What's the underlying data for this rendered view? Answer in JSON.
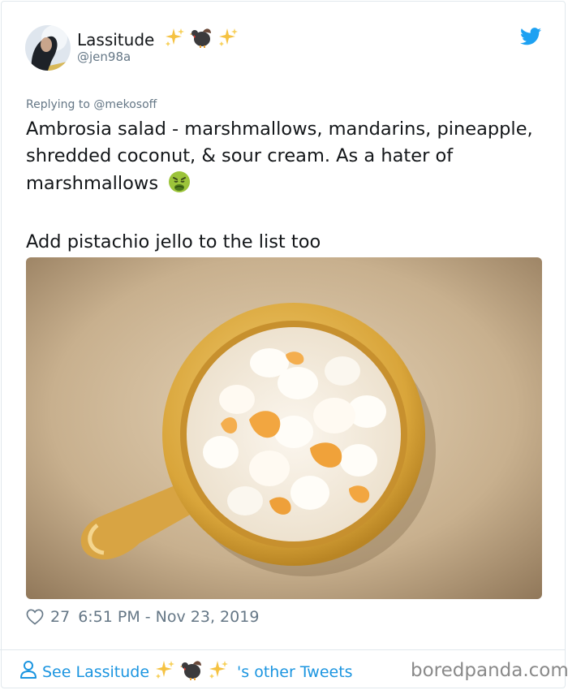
{
  "tweet": {
    "author_name": "Lassitude",
    "author_name_emojis": [
      "sparkles-icon",
      "turkey-icon",
      "sparkles-icon"
    ],
    "handle": "@jen98a",
    "replying_to": "Replying to @mekosoff",
    "text_line1": "Ambrosia salad - marshmallows, mandarins, pineapple, shredded coconut, & sour cream. As a hater of marshmallows",
    "text_emoji": "nauseated-face-icon",
    "text_line2": "Add pistachio jello to the list too",
    "photo_alt": "bowl of ambrosia salad",
    "likes": "27",
    "timestamp": "6:51 PM - Nov 23, 2019"
  },
  "footer": {
    "see_prefix": "See Lassitude",
    "see_suffix": "'s other Tweets",
    "watermark": "boredpanda.com"
  },
  "colors": {
    "text": "#14171a",
    "muted": "#657786",
    "link": "#1b95e0",
    "twitter_blue": "#1da1f2"
  }
}
